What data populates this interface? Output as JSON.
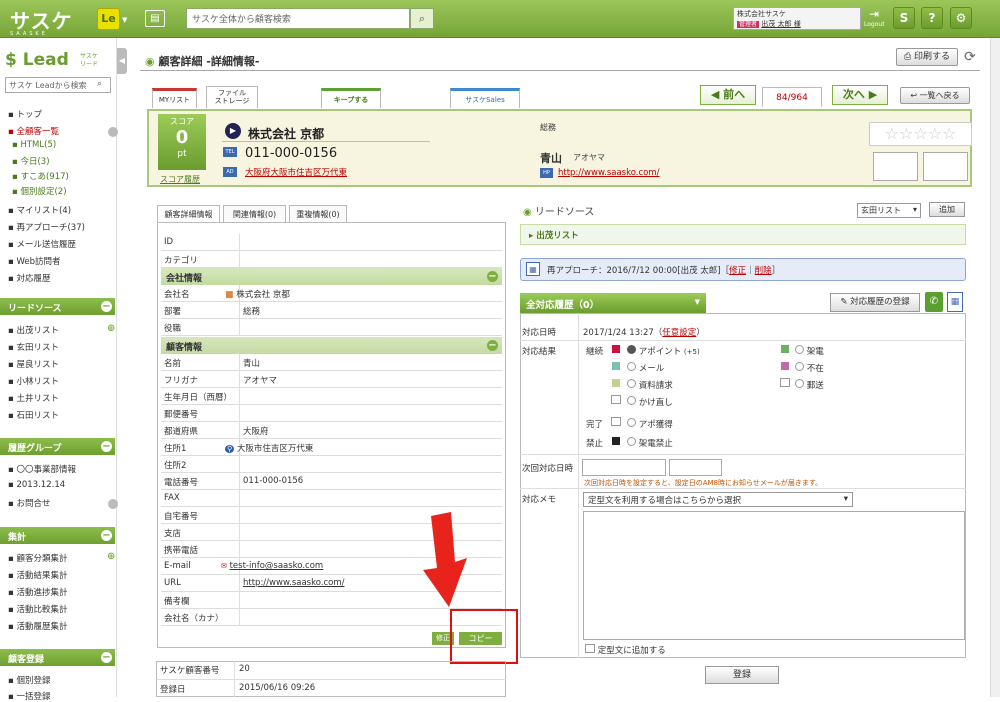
{
  "header": {
    "logo": "サスケ",
    "logo_sub": "SAASKE",
    "le_label": "Le",
    "search_placeholder": "サスケ全体から顧客検索",
    "company": "株式会社サスケ",
    "user_tag": "管理者",
    "user_name": "出茂 太郎 様",
    "logout": "Logout",
    "help": "?"
  },
  "sidebar": {
    "logo": "Lead",
    "logo_sub1": "サスケ",
    "logo_sub2": "リード",
    "search_placeholder": "サスケ Leadから検索",
    "main_items": [
      "トップ",
      "全顧客一覧",
      "HTML(5)",
      "今日(3)",
      "すこあ(917)",
      "個別設定(2)",
      "マイリスト(4)",
      "再アプローチ(37)",
      "メール送信履歴",
      "Web訪問者",
      "対応履歴"
    ],
    "section_leadsource": "リードソース",
    "leadsource_items": [
      "出茂リスト",
      "玄田リスト",
      "屋良リスト",
      "小林リスト",
      "土井リスト",
      "石田リスト"
    ],
    "section_history": "履歴グループ",
    "history_items": [
      "〇〇事業部情報",
      "2013.12.14",
      "お問合せ"
    ],
    "section_stats": "集計",
    "stats_items": [
      "顧客分類集計",
      "活動結果集計",
      "活動進捗集計",
      "活動比較集計",
      "活動履歴集計"
    ],
    "section_register": "顧客登録",
    "register_items": [
      "個別登録",
      "一括登録"
    ]
  },
  "page": {
    "title": "顧客詳細 -詳細情報-",
    "print": "印刷する",
    "tab_mylist": "MYリスト",
    "tab_file1": "ファイル",
    "tab_file2": "ストレージ",
    "tab_keep": "キープする",
    "tab_sales": "サスケSales",
    "prev": "前へ",
    "count": "84/964",
    "next": "次へ",
    "back": "一覧へ戻る"
  },
  "profile": {
    "score_label": "スコア",
    "score": "0",
    "score_unit": "pt",
    "score_history": "スコア履歴",
    "company": "株式会社 京都",
    "tel_badge": "TEL",
    "tel": "011-000-0156",
    "addr_badge": "AD",
    "address": "大阪府大阪市住吉区万代東",
    "dept": "総務",
    "contact": "青山",
    "contact_kana": "アオヤマ",
    "hp_badge": "HP",
    "url": "http://www.saasko.com/",
    "stars": "☆☆☆☆☆"
  },
  "detail": {
    "tabs": [
      "顧客詳細情報",
      "関連情報(0)",
      "重複情報(0)"
    ],
    "rows_top": [
      {
        "k": "ID",
        "v": ""
      },
      {
        "k": "カテゴリ",
        "v": ""
      }
    ],
    "section_company": "会社情報",
    "rows_company": [
      {
        "k": "会社名",
        "v": "株式会社 京都"
      },
      {
        "k": "部署",
        "v": "総務"
      },
      {
        "k": "役職",
        "v": ""
      }
    ],
    "section_customer": "顧客情報",
    "rows_customer": [
      {
        "k": "名前",
        "v": "青山"
      },
      {
        "k": "フリガナ",
        "v": "アオヤマ"
      },
      {
        "k": "生年月日（西暦）",
        "v": ""
      },
      {
        "k": "郵便番号",
        "v": ""
      },
      {
        "k": "都道府県",
        "v": "大阪府"
      },
      {
        "k": "住所1",
        "v": "大阪市住吉区万代東"
      },
      {
        "k": "住所2",
        "v": ""
      },
      {
        "k": "電話番号",
        "v": "011-000-0156"
      },
      {
        "k": "FAX",
        "v": ""
      },
      {
        "k": "自宅番号",
        "v": ""
      },
      {
        "k": "支店",
        "v": ""
      },
      {
        "k": "携帯電話",
        "v": ""
      },
      {
        "k": "E-mail",
        "v": "test-info@saasko.com"
      },
      {
        "k": "URL",
        "v": "http://www.saasko.com/"
      },
      {
        "k": "備考欄",
        "v": ""
      },
      {
        "k": "会社名（カナ）",
        "v": ""
      }
    ],
    "edit": "修正",
    "copy": "コピー",
    "saaske_no_label": "サスケ顧客番号",
    "saaske_no": "20",
    "reg_date_label": "登録日",
    "reg_date": "2015/06/16 09:26"
  },
  "right": {
    "lead_source": "リードソース",
    "select": "玄田リスト",
    "add": "追加",
    "src_item": "出茂リスト",
    "reapproach": "再アプローチ：2016/7/12 00:00[出茂 太郎]",
    "reapp_edit": "修正",
    "reapp_delete": "削除",
    "hist_tab": "全対応履歴（0）",
    "reg_hist": "対応履歴の登録",
    "label_datetime": "対応日時",
    "datetime": "2017/1/24 13:27",
    "arbitrary": "任意設定",
    "label_result": "対応結果",
    "cat_continue": "継続",
    "cat_done": "完了",
    "cat_ban": "禁止",
    "opt_appoint": "アポイント",
    "opt_appoint_count": "(+5)",
    "opt_mail": "メール",
    "opt_docs": "資料請求",
    "opt_recall": "かけ直し",
    "opt_absent_call": "架電",
    "opt_away": "不在",
    "opt_post": "郵送",
    "opt_apo_get": "アポ獲得",
    "opt_call_ban": "架電禁止",
    "label_next": "次回対応日時",
    "next_note": "次回対応日時を設定すると、設定日のAM8時にお知らせメールが届きます。",
    "label_memo": "対応メモ",
    "memo_select": "定型文を利用する場合はこちらから選択",
    "tmpl_add": "定型文に追加する",
    "submit": "登録"
  }
}
